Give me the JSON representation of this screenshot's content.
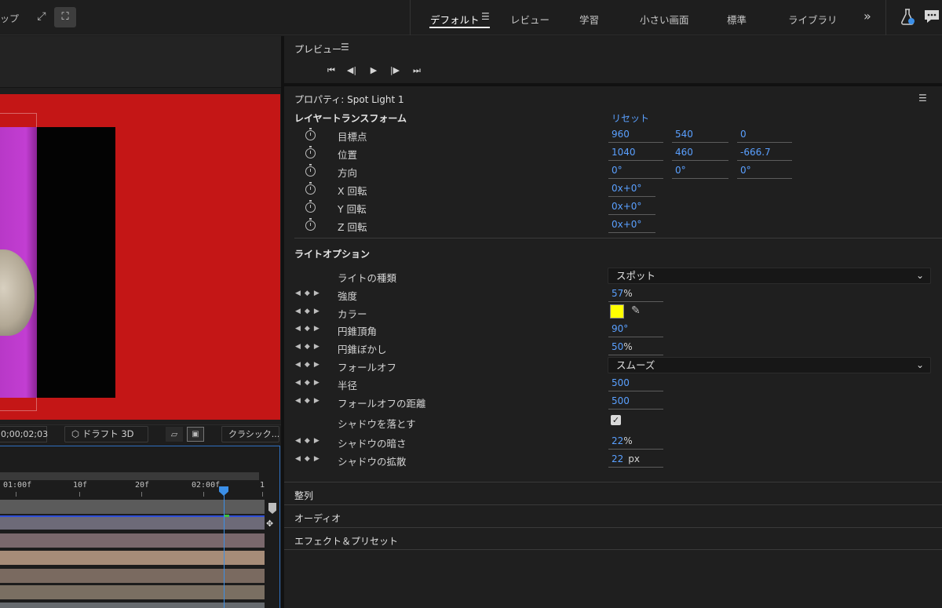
{
  "topbar": {
    "left_partial_text": "ップ",
    "workspaces": [
      {
        "label": "デフォルト",
        "active": true
      },
      {
        "label": "レビュー",
        "active": false
      },
      {
        "label": "学習",
        "active": false
      },
      {
        "label": "小さい画面",
        "active": false
      },
      {
        "label": "標準",
        "active": false
      },
      {
        "label": "ライブラリ",
        "active": false
      }
    ],
    "more": "»"
  },
  "composition": {
    "timecode": "0;00;02;03",
    "draft_3d": "ドラフト 3D",
    "renderer": "クラシック..."
  },
  "timeline": {
    "ruler_labels": [
      "01:00f",
      "10f",
      "20f",
      "02:00f",
      "1"
    ],
    "track_colors": [
      "#5b5b5b",
      "#6d6a78",
      "#7a686c",
      "#a68c78",
      "#7a6a60",
      "#7a6f62",
      "#666a6e"
    ]
  },
  "preview": {
    "title": "プレビュー",
    "controls": [
      "first-frame",
      "previous-frame",
      "play",
      "next-frame",
      "last-frame"
    ]
  },
  "properties": {
    "title": "プロパティ: Spot Light 1",
    "layer_transform": {
      "section_title": "レイヤートランスフォーム",
      "reset": "リセット",
      "rows": [
        {
          "label": "目標点",
          "values": [
            "960",
            "540",
            "0"
          ]
        },
        {
          "label": "位置",
          "values": [
            "1040",
            "460",
            "-666.7"
          ]
        },
        {
          "label": "方向",
          "values": [
            "0°",
            "0°",
            "0°"
          ]
        },
        {
          "label": "X 回転",
          "values": [
            "0x+0°"
          ]
        },
        {
          "label": "Y 回転",
          "values": [
            "0x+0°"
          ]
        },
        {
          "label": "Z 回転",
          "values": [
            "0x+0°"
          ]
        }
      ]
    },
    "light_options": {
      "section_title": "ライトオプション",
      "light_type_label": "ライトの種類",
      "light_type_value": "スポット",
      "intensity_label": "強度",
      "intensity_value": "57",
      "intensity_unit": "%",
      "color_label": "カラー",
      "color_value": "#ffff00",
      "cone_angle_label": "円錐頂角",
      "cone_angle_value": "90°",
      "cone_feather_label": "円錐ぼかし",
      "cone_feather_value": "50",
      "cone_feather_unit": "%",
      "falloff_label": "フォールオフ",
      "falloff_value": "スムーズ",
      "radius_label": "半径",
      "radius_value": "500",
      "falloff_distance_label": "フォールオフの距離",
      "falloff_distance_value": "500",
      "casts_shadows_label": "シャドウを落とす",
      "casts_shadows_checked": true,
      "shadow_darkness_label": "シャドウの暗さ",
      "shadow_darkness_value": "22",
      "shadow_darkness_unit": "%",
      "shadow_diffusion_label": "シャドウの拡散",
      "shadow_diffusion_value": "22",
      "shadow_diffusion_unit": "px"
    },
    "collapsed_sections": [
      "整列",
      "オーディオ",
      "エフェクト＆プリセット"
    ]
  },
  "colors": {
    "accent_blue": "#5aa0ff",
    "viewer_background": "#c41616",
    "playhead": "#3b8fe8"
  }
}
